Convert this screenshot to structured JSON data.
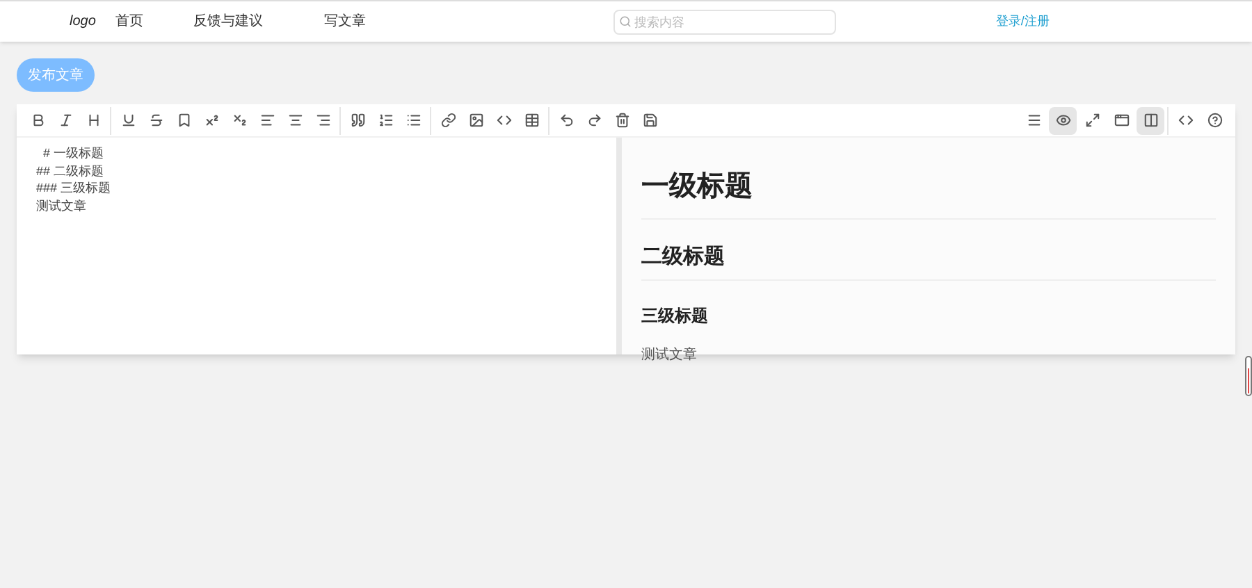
{
  "navbar": {
    "logo": "logo",
    "links": [
      "首页",
      "反馈与建议",
      "写文章"
    ],
    "search": {
      "placeholder": "搜索内容"
    },
    "login": "登录/注册"
  },
  "publish_button": "发布文章",
  "editor": {
    "toolbar_left": [
      [
        {
          "kind": "bold"
        },
        {
          "kind": "italic"
        },
        {
          "kind": "heading"
        }
      ],
      [
        {
          "kind": "underline"
        },
        {
          "kind": "strikethrough"
        },
        {
          "kind": "bookmark"
        },
        {
          "kind": "superscript"
        },
        {
          "kind": "subscript"
        },
        {
          "kind": "align-left"
        },
        {
          "kind": "align-center"
        },
        {
          "kind": "align-right"
        }
      ],
      [
        {
          "kind": "quote"
        },
        {
          "kind": "ordered-list"
        },
        {
          "kind": "list"
        }
      ],
      [
        {
          "kind": "link"
        },
        {
          "kind": "image"
        },
        {
          "kind": "code"
        },
        {
          "kind": "table"
        }
      ],
      [
        {
          "kind": "undo"
        },
        {
          "kind": "redo"
        },
        {
          "kind": "trash"
        },
        {
          "kind": "save"
        }
      ]
    ],
    "toolbar_right": [
      [
        {
          "kind": "navigation",
          "selected": false
        },
        {
          "kind": "preview",
          "selected": true
        },
        {
          "kind": "fullscreen",
          "selected": false
        },
        {
          "kind": "read",
          "selected": false
        },
        {
          "kind": "subfield",
          "selected": true
        }
      ],
      [
        {
          "kind": "html",
          "selected": false
        },
        {
          "kind": "help",
          "selected": false
        }
      ]
    ],
    "source_lines": [
      "  # 一级标题",
      "## 二级标题",
      "### 三级标题",
      "测试文章"
    ],
    "preview": [
      {
        "kind": "h1",
        "text": "一级标题"
      },
      {
        "kind": "h2",
        "text": "二级标题"
      },
      {
        "kind": "h3",
        "text": "三级标题"
      },
      {
        "kind": "p",
        "text": "测试文章"
      }
    ]
  }
}
